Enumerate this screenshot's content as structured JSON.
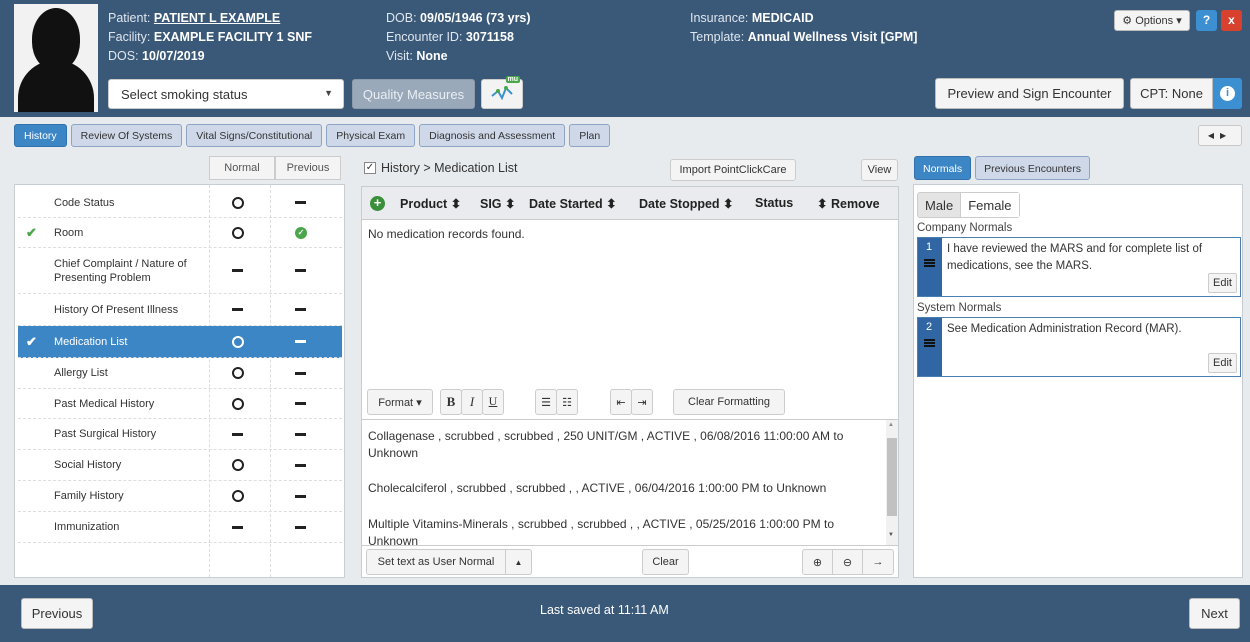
{
  "header": {
    "patient_label": "Patient:",
    "patient_name": "PATIENT L EXAMPLE",
    "facility_label": "Facility:",
    "facility_name": "EXAMPLE FACILITY 1 SNF",
    "dos_label": "DOS:",
    "dos_value": "10/07/2019",
    "dob_label": "DOB:",
    "dob_value": "09/05/1946 (73 yrs)",
    "encounter_label": "Encounter ID:",
    "encounter_value": "3071158",
    "visit_label": "Visit:",
    "visit_value": "None",
    "insurance_label": "Insurance:",
    "insurance_value": "MEDICAID",
    "template_label": "Template:",
    "template_value": "Annual Wellness Visit [GPM]",
    "smoking_placeholder": "Select smoking status",
    "quality_measures": "Quality Measures",
    "mu_badge": "mu",
    "options": "Options",
    "help": "?",
    "close": "x",
    "preview_sign": "Preview and Sign Encounter",
    "cpt": "CPT: None",
    "info": "i"
  },
  "tabs": [
    "History",
    "Review Of Systems",
    "Vital Signs/Constitutional",
    "Physical Exam",
    "Diagnosis and Assessment",
    "Plan"
  ],
  "left": {
    "normal_header": "Normal",
    "previous_header": "Previous",
    "items": [
      {
        "label": "Code Status",
        "checked": false,
        "normal": "circle",
        "previous": "dash",
        "selected": false
      },
      {
        "label": "Room",
        "checked": true,
        "normal": "circle",
        "previous": "check",
        "selected": false
      },
      {
        "label": "Chief Complaint / Nature of Presenting Problem",
        "checked": false,
        "normal": "dash",
        "previous": "dash",
        "selected": false
      },
      {
        "label": "History Of Present Illness",
        "checked": false,
        "normal": "dash",
        "previous": "dash",
        "selected": false
      },
      {
        "label": "Medication List",
        "checked": true,
        "normal": "circle",
        "previous": "dash",
        "selected": true
      },
      {
        "label": "Allergy List",
        "checked": false,
        "normal": "circle",
        "previous": "dash",
        "selected": false
      },
      {
        "label": "Past Medical History",
        "checked": false,
        "normal": "circle",
        "previous": "dash",
        "selected": false
      },
      {
        "label": "Past Surgical History",
        "checked": false,
        "normal": "dash",
        "previous": "dash",
        "selected": false
      },
      {
        "label": "Social History",
        "checked": false,
        "normal": "circle",
        "previous": "dash",
        "selected": false
      },
      {
        "label": "Family History",
        "checked": false,
        "normal": "circle",
        "previous": "dash",
        "selected": false
      },
      {
        "label": "Immunization",
        "checked": false,
        "normal": "dash",
        "previous": "dash",
        "selected": false
      }
    ]
  },
  "middle": {
    "breadcrumb": "History > Medication List",
    "import_btn": "Import PointClickCare",
    "view_btn": "View",
    "columns": [
      "Product",
      "SIG",
      "Date Started",
      "Date Stopped",
      "Status",
      "Remove"
    ],
    "no_records": "No medication records found.",
    "format_btn": "Format",
    "bold": "B",
    "italic": "I",
    "underline": "U",
    "clear_formatting": "Clear Formatting",
    "notes": [
      "Collagenase , scrubbed , scrubbed , 250 UNIT/GM , ACTIVE , 06/08/2016 11:00:00 AM to Unknown",
      "Cholecalciferol , scrubbed , scrubbed , , ACTIVE , 06/04/2016 1:00:00 PM to Unknown",
      "Multiple Vitamins-Minerals , scrubbed , scrubbed , , ACTIVE , 05/25/2016 1:00:00 PM to Unknown"
    ],
    "set_user_normal": "Set text as User Normal",
    "clear": "Clear"
  },
  "right": {
    "tabs": [
      "Normals",
      "Previous Encounters"
    ],
    "sex_options": [
      "Male",
      "Female"
    ],
    "company_normals_label": "Company Normals",
    "company_normal": {
      "num": "1",
      "text": "I have reviewed the MARS and for complete list of medications, see the MARS.",
      "edit": "Edit"
    },
    "system_normals_label": "System Normals",
    "system_normal": {
      "num": "2",
      "text": "See Medication Administration Record (MAR).",
      "edit": "Edit"
    }
  },
  "footer": {
    "previous": "Previous",
    "saved": "Last saved at 11:11 AM",
    "next": "Next"
  }
}
